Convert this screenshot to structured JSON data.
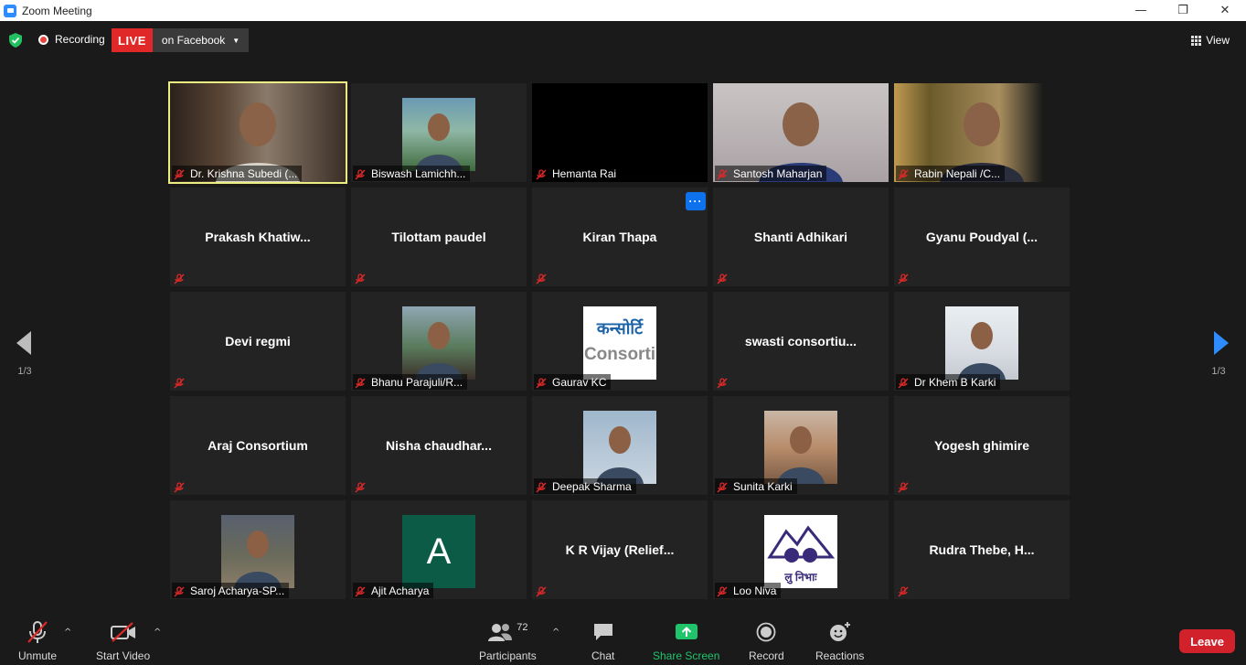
{
  "window": {
    "title": "Zoom Meeting",
    "minimize": "—",
    "maximize": "❐",
    "close": "✕"
  },
  "topbar": {
    "recording_label": "Recording",
    "live_badge": "LIVE",
    "live_target": "on Facebook",
    "view_label": "View"
  },
  "gallery": {
    "page_left": "1/3",
    "page_right": "1/3",
    "tiles": [
      {
        "name": "Dr. Krishna Subedi (...",
        "type": "video"
      },
      {
        "name": "Biswash Lamichh...",
        "type": "photo"
      },
      {
        "name": "Hemanta Rai",
        "type": "black"
      },
      {
        "name": "Santosh Maharjan",
        "type": "video"
      },
      {
        "name": "Rabin Nepali /C...",
        "type": "video"
      },
      {
        "name": "Prakash  Khatiw...",
        "type": "name"
      },
      {
        "name": "Tilottam paudel",
        "type": "name"
      },
      {
        "name": "Kiran Thapa",
        "type": "name",
        "more": "···"
      },
      {
        "name": "Shanti Adhikari",
        "type": "name"
      },
      {
        "name": "Gyanu  Poudyal  (...",
        "type": "name"
      },
      {
        "name": "Devi regmi",
        "type": "name"
      },
      {
        "name": "Bhanu Parajuli/R...",
        "type": "photo"
      },
      {
        "name": "Gaurav KC",
        "type": "logo",
        "logo_line1": "कन्सोर्टि",
        "logo_line2": "Consorti"
      },
      {
        "name": "swasti  consortiu...",
        "type": "name"
      },
      {
        "name": "Dr Khem B Karki",
        "type": "photo"
      },
      {
        "name": "Araj Consortium",
        "type": "name"
      },
      {
        "name": "Nisha  chaudhar...",
        "type": "name"
      },
      {
        "name": "Deepak Sharma",
        "type": "photo"
      },
      {
        "name": "Sunita Karki",
        "type": "photo"
      },
      {
        "name": "Yogesh ghimire",
        "type": "name"
      },
      {
        "name": "Saroj Acharya-SP...",
        "type": "photo"
      },
      {
        "name": "Ajit Acharya",
        "type": "avatar",
        "initial": "A"
      },
      {
        "name": "K  R  Vijay  (Relief...",
        "type": "name"
      },
      {
        "name": "Loo Niva",
        "type": "logo2",
        "logo_text": "लु निभाः"
      },
      {
        "name": "Rudra  Thebe,  H...",
        "type": "name"
      }
    ]
  },
  "toolbar": {
    "unmute": "Unmute",
    "start_video": "Start Video",
    "participants": "Participants",
    "participants_count": "72",
    "chat": "Chat",
    "share_screen": "Share Screen",
    "record": "Record",
    "reactions": "Reactions",
    "leave": "Leave"
  },
  "colors": {
    "accent_green": "#20c46a",
    "live_red": "#e02828",
    "leave_red": "#d1222b",
    "speaker_outline": "#ecee81",
    "nav_blue": "#2d8cff"
  }
}
